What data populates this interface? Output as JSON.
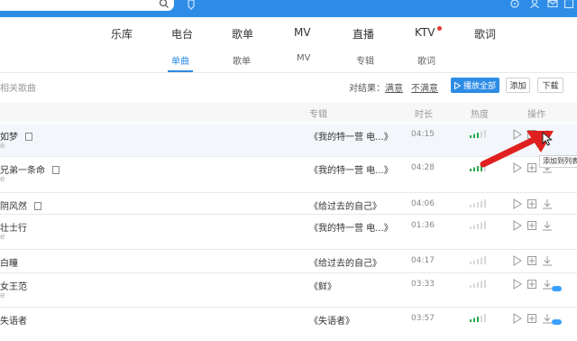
{
  "nav": {
    "tabs": [
      "乐库",
      "电台",
      "歌单",
      "MV",
      "直播",
      "KTV",
      "歌词"
    ],
    "subtabs": [
      "单曲",
      "歌单",
      "MV",
      "专辑",
      "歌词"
    ]
  },
  "toolbar": {
    "related_label": "相关歌曲",
    "filter_label": "对结果：",
    "satisfied": "满意",
    "unsatisfied": "不满意",
    "play_all": "播放全部",
    "add": "添加",
    "download": "下载"
  },
  "table": {
    "headers": {
      "album": "专辑",
      "duration": "时长",
      "heat": "热度",
      "ops": "操作"
    },
    "rows": [
      {
        "title": "如梦",
        "mv": true,
        "sub": "e",
        "album": "《我的特一营 电...》",
        "duration": "04:15",
        "heat": 3
      },
      {
        "title": "兄弟一条命",
        "mv": true,
        "sub": "e",
        "album": "《我的特一营 电...》",
        "duration": "04:28",
        "heat": 4
      },
      {
        "title": "阴风然",
        "mv": true,
        "sub": "",
        "album": "《给过去的自己》",
        "duration": "04:06",
        "heat": 0
      },
      {
        "title": "壮士行",
        "mv": false,
        "sub": "e",
        "album": "《我的特一营 电...》",
        "duration": "01:36",
        "heat": 0
      },
      {
        "title": "白瞳",
        "mv": false,
        "sub": "",
        "album": "《给过去的自己》",
        "duration": "04:17",
        "heat": 0
      },
      {
        "title": "女王范",
        "mv": false,
        "sub": "e",
        "album": "《鲜》",
        "duration": "03:33",
        "heat": 0
      },
      {
        "title": "失语者",
        "mv": false,
        "sub": "",
        "album": "《失语者》",
        "duration": "03:57",
        "heat": 3
      }
    ]
  },
  "tooltip": "添加到列表",
  "colors": {
    "accent": "#2d8ce6",
    "heat": "#2aa84a",
    "arrow": "#e02020"
  }
}
